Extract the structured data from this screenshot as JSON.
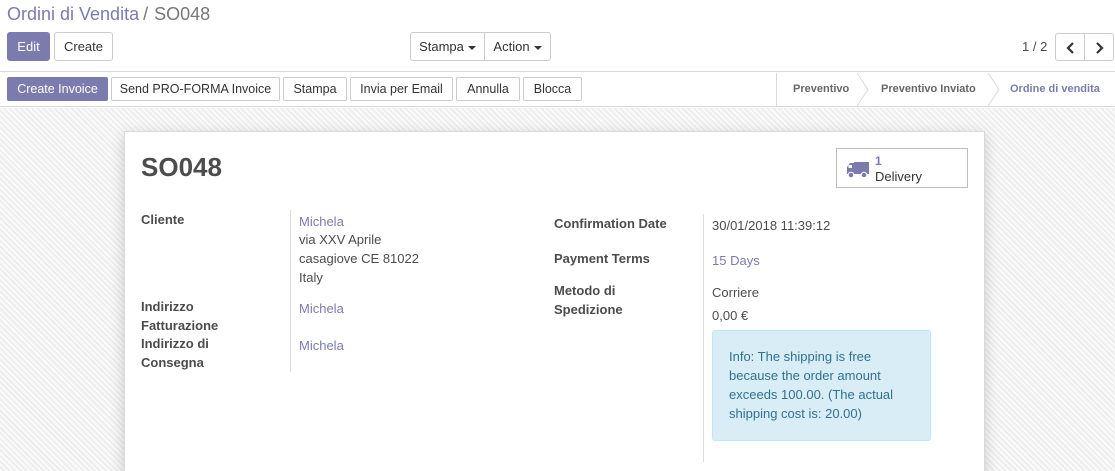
{
  "breadcrumb": {
    "parent": "Ordini di Vendita",
    "separator": "/",
    "current": "SO048"
  },
  "buttons": {
    "edit": "Edit",
    "create": "Create",
    "print": "Stampa",
    "action": "Action"
  },
  "pager": {
    "value": "1 / 2"
  },
  "statusbar": {
    "buttons": [
      "Create Invoice",
      "Send PRO-FORMA Invoice",
      "Stampa",
      "Invia per Email",
      "Annulla",
      "Blocca"
    ],
    "steps": [
      "Preventivo",
      "Preventivo Inviato",
      "Ordine di vendita"
    ],
    "current_step": "Ordine di vendita"
  },
  "record": {
    "name": "SO048",
    "smart_button": {
      "count": "1",
      "label": "Delivery",
      "icon": "truck-icon"
    },
    "left": {
      "customer_label": "Cliente",
      "customer_name": "Michela",
      "customer_address": [
        "via XXV Aprile",
        "casagiove CE 81022",
        "Italy"
      ],
      "invoice_address_label": [
        "Indirizzo",
        "Fatturazione"
      ],
      "invoice_address": "Michela",
      "delivery_address_label": [
        "Indirizzo di",
        "Consegna"
      ],
      "delivery_address": "Michela"
    },
    "right": {
      "confirmation_label": "Confirmation Date",
      "confirmation_value": "30/01/2018 11:39:12",
      "payment_terms_label": "Payment Terms",
      "payment_terms_value": "15 Days",
      "shipping_label": [
        "Metodo di",
        "Spedizione"
      ],
      "shipping_value": "Corriere",
      "shipping_price": "0,00 €",
      "info": [
        "Info: The shipping is free",
        "because the order amount",
        "exceeds 100.00. (The actual",
        "shipping cost is: 20.00)"
      ]
    }
  },
  "colors": {
    "primary": "#7c7bad",
    "info_bg": "#d9edf7",
    "info_text": "#31708f"
  }
}
